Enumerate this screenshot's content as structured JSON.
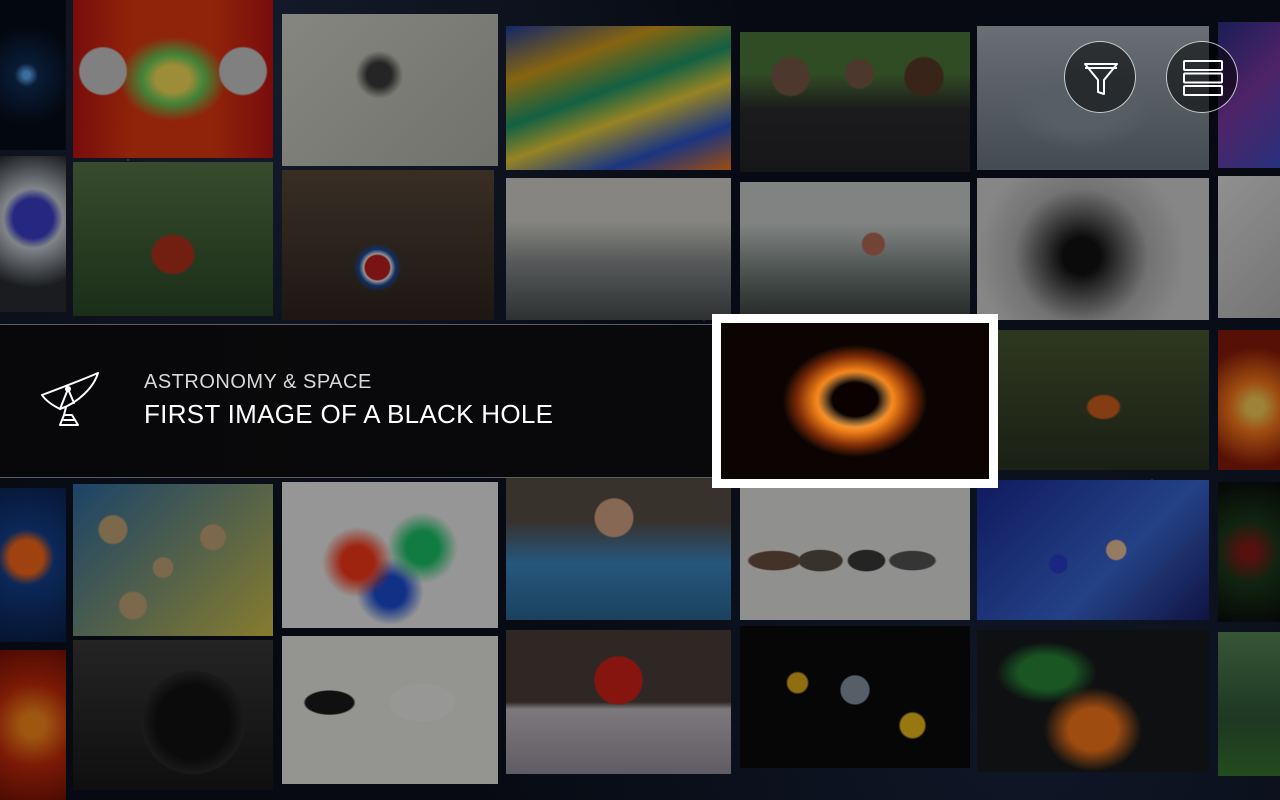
{
  "featured": {
    "category": "ASTRONOMY & SPACE",
    "title": "FIRST IMAGE OF A BLACK HOLE",
    "category_icon": "satellite-dish-icon"
  },
  "controls": {
    "filter_icon": "funnel-icon",
    "menu_icon": "list-menu-icon"
  }
}
